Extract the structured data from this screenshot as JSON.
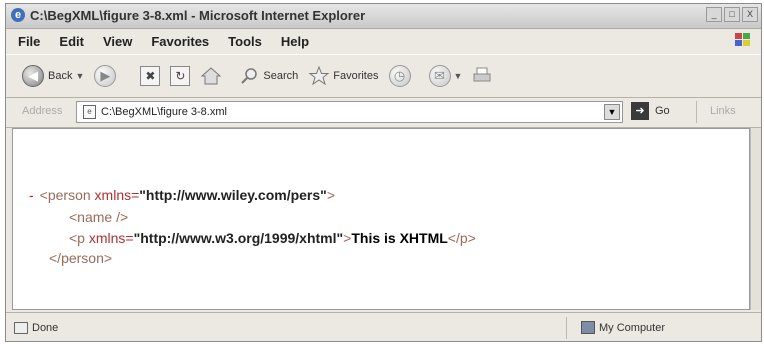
{
  "window": {
    "title": "C:\\BegXML\\figure 3-8.xml - Microsoft Internet Explorer",
    "buttons": [
      "_",
      "□",
      "X"
    ]
  },
  "menu": [
    "File",
    "Edit",
    "View",
    "Favorites",
    "Tools",
    "Help"
  ],
  "toolbar": {
    "back_label": "Back",
    "search_label": "Search",
    "favorites_label": "Favorites"
  },
  "address": {
    "label": "Address",
    "url": "C:\\BegXML\\figure 3-8.xml",
    "go_label": "Go",
    "links_label": "Links"
  },
  "xml": {
    "line1": {
      "toggle": "-",
      "open": "<person",
      "attr": " xmlns=",
      "value": "\"http://www.wiley.com/pers\"",
      "close": ">"
    },
    "line2": {
      "tag": "<name />"
    },
    "line3": {
      "open": "<p",
      "attr": " xmlns=",
      "value": "\"http://www.w3.org/1999/xhtml\"",
      "gt": ">",
      "text": "This is XHTML",
      "close": "</p>"
    },
    "line4": {
      "tag": "</person>"
    }
  },
  "status": {
    "text": "Done",
    "zone": "My Computer"
  }
}
